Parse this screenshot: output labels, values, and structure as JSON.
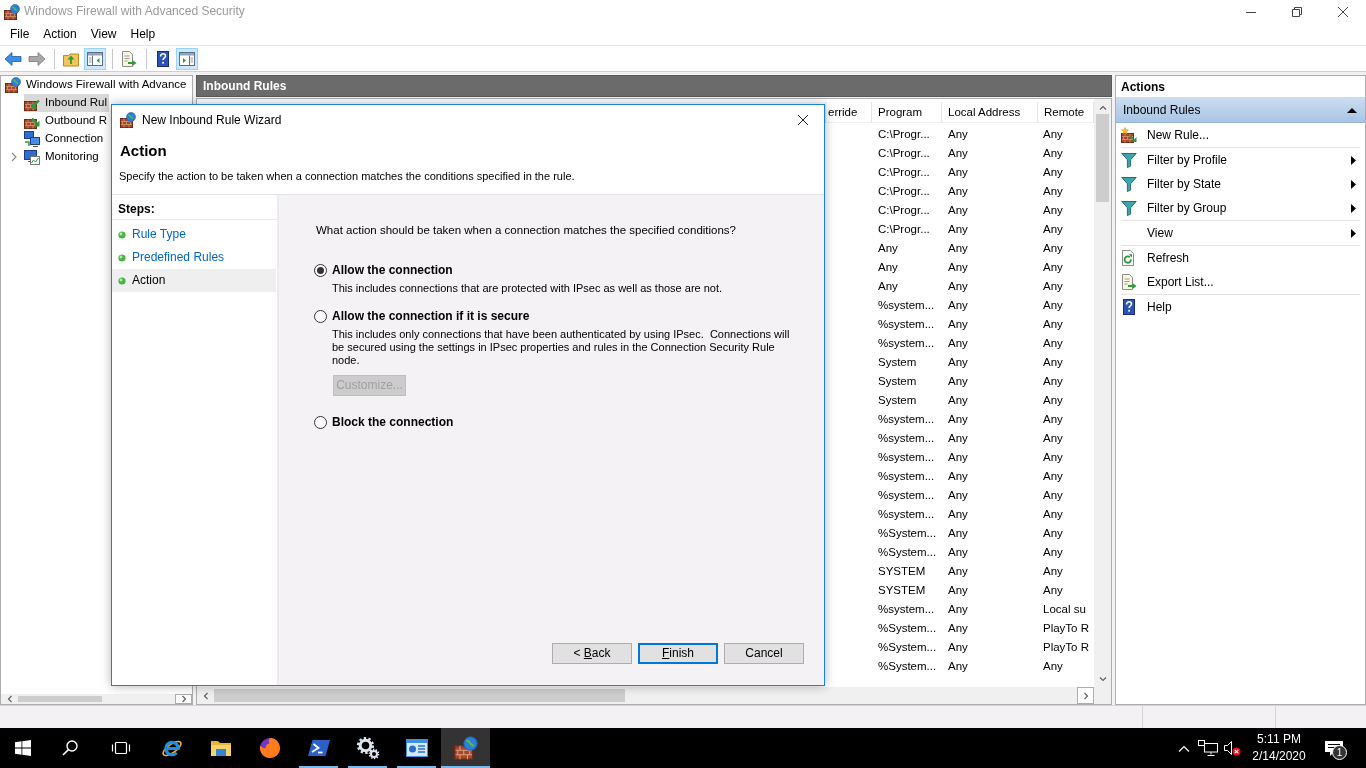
{
  "window": {
    "title": "Windows Firewall with Advanced Security",
    "active": false
  },
  "menu": [
    "File",
    "Action",
    "View",
    "Help"
  ],
  "toolbar": [
    {
      "buttons": [
        {
          "kind": "back",
          "pressed": false,
          "disabled": false
        },
        {
          "kind": "forward",
          "pressed": false,
          "disabled": true
        }
      ]
    },
    {
      "buttons": [
        {
          "kind": "up",
          "pressed": false,
          "disabled": false
        },
        {
          "kind": "console-tree",
          "pressed": true,
          "disabled": false
        }
      ]
    },
    {
      "buttons": [
        {
          "kind": "export",
          "pressed": false,
          "disabled": false
        }
      ]
    },
    {
      "buttons": [
        {
          "kind": "help",
          "pressed": false,
          "disabled": false
        },
        {
          "kind": "action-pane",
          "pressed": true,
          "disabled": false
        }
      ]
    }
  ],
  "tree": [
    {
      "label": "Windows Firewall with Advance",
      "kind": "root",
      "selected": false,
      "children": [
        {
          "label": "Inbound Rul",
          "kind": "inbound",
          "selected": true
        },
        {
          "label": "Outbound R",
          "kind": "outbound",
          "selected": false
        },
        {
          "label": "Connection",
          "kind": "connection",
          "selected": false
        },
        {
          "label": "Monitoring",
          "kind": "monitoring",
          "selected": false,
          "expanded": false
        }
      ]
    }
  ],
  "center": {
    "title": "Inbound Rules",
    "table": {
      "columns": [
        "erride",
        "Program",
        "Local Address",
        "Remote"
      ],
      "rows": [
        [
          "",
          "C:\\Progr...",
          "Any",
          "Any"
        ],
        [
          "",
          "C:\\Progr...",
          "Any",
          "Any"
        ],
        [
          "",
          "C:\\Progr...",
          "Any",
          "Any"
        ],
        [
          "",
          "C:\\Progr...",
          "Any",
          "Any"
        ],
        [
          "",
          "C:\\Progr...",
          "Any",
          "Any"
        ],
        [
          "",
          "C:\\Progr...",
          "Any",
          "Any"
        ],
        [
          "",
          "Any",
          "Any",
          "Any"
        ],
        [
          "",
          "Any",
          "Any",
          "Any"
        ],
        [
          "",
          "Any",
          "Any",
          "Any"
        ],
        [
          "",
          "%system...",
          "Any",
          "Any"
        ],
        [
          "",
          "%system...",
          "Any",
          "Any"
        ],
        [
          "",
          "%system...",
          "Any",
          "Any"
        ],
        [
          "",
          "System",
          "Any",
          "Any"
        ],
        [
          "",
          "System",
          "Any",
          "Any"
        ],
        [
          "",
          "System",
          "Any",
          "Any"
        ],
        [
          "",
          "%system...",
          "Any",
          "Any"
        ],
        [
          "",
          "%system...",
          "Any",
          "Any"
        ],
        [
          "",
          "%system...",
          "Any",
          "Any"
        ],
        [
          "",
          "%system...",
          "Any",
          "Any"
        ],
        [
          "",
          "%system...",
          "Any",
          "Any"
        ],
        [
          "",
          "%system...",
          "Any",
          "Any"
        ],
        [
          "",
          "%System...",
          "Any",
          "Any"
        ],
        [
          "",
          "%System...",
          "Any",
          "Any"
        ],
        [
          "",
          "SYSTEM",
          "Any",
          "Any"
        ],
        [
          "",
          "SYSTEM",
          "Any",
          "Any"
        ],
        [
          "",
          "%system...",
          "Any",
          "Local su"
        ],
        [
          "",
          "%System...",
          "Any",
          "PlayTo R"
        ],
        [
          "",
          "%System...",
          "Any",
          "PlayTo R"
        ],
        [
          "",
          "%System...",
          "Any",
          "Any"
        ]
      ]
    }
  },
  "actions": {
    "title": "Actions",
    "section": {
      "title": "Inbound Rules",
      "expanded": true,
      "groups": [
        {
          "items": [
            {
              "label": "New Rule...",
              "kind": "new-rule",
              "submenu": false
            }
          ]
        },
        {
          "items": [
            {
              "label": "Filter by Profile",
              "kind": "filter",
              "submenu": true
            },
            {
              "label": "Filter by State",
              "kind": "filter",
              "submenu": true
            },
            {
              "label": "Filter by Group",
              "kind": "filter",
              "submenu": true
            }
          ]
        },
        {
          "items": [
            {
              "label": "View",
              "kind": "plain",
              "submenu": true
            }
          ]
        },
        {
          "items": [
            {
              "label": "Refresh",
              "kind": "refresh",
              "submenu": false
            },
            {
              "label": "Export List...",
              "kind": "export",
              "submenu": false
            }
          ]
        },
        {
          "items": [
            {
              "label": "Help",
              "kind": "help",
              "submenu": false
            }
          ]
        }
      ]
    }
  },
  "dialog": {
    "title": "New Inbound Rule Wizard",
    "heading": "Action",
    "description": "Specify the action to be taken when a connection matches the conditions specified in the rule.",
    "steps_title": "Steps:",
    "steps": [
      {
        "label": "Rule Type",
        "selected": false
      },
      {
        "label": "Predefined Rules",
        "selected": false
      },
      {
        "label": "Action",
        "selected": true
      }
    ],
    "question": "What action should be taken when a connection matches the specified conditions?",
    "options": [
      {
        "label": "Allow the connection",
        "selected": true,
        "description": "This includes connections that are protected with IPsec as well as those are not."
      },
      {
        "label": "Allow the connection if it is secure",
        "selected": false,
        "description": "This includes only connections that have been authenticated by using IPsec.  Connections will be secured using the settings in IPsec properties and rules in the Connection Security Rule node.",
        "button": {
          "label": "Customize...",
          "disabled": true
        }
      },
      {
        "label": "Block the connection",
        "selected": false
      }
    ],
    "buttons": [
      {
        "parts": [
          {
            "text": "< ",
            "underline": false
          },
          {
            "text": "B",
            "underline": true
          },
          {
            "text": "ack",
            "underline": false
          }
        ],
        "default": false,
        "disabled": false
      },
      {
        "parts": [
          {
            "text": "F",
            "underline": true
          },
          {
            "text": "inish",
            "underline": false
          }
        ],
        "default": true,
        "disabled": false
      },
      {
        "parts": [
          {
            "text": "Cancel",
            "underline": false
          }
        ],
        "default": false,
        "disabled": false
      }
    ]
  },
  "taskbar": {
    "system_buttons": [
      {
        "kind": "start"
      },
      {
        "kind": "search"
      },
      {
        "kind": "task-view"
      }
    ],
    "apps": [
      {
        "kind": "ie",
        "running": false,
        "active": false
      },
      {
        "kind": "explorer",
        "running": false,
        "active": false
      },
      {
        "kind": "firefox",
        "running": false,
        "active": false
      },
      {
        "kind": "powershell",
        "running": true,
        "active": false
      },
      {
        "kind": "settings",
        "running": true,
        "active": false
      },
      {
        "kind": "window-chart",
        "running": true,
        "active": false
      },
      {
        "kind": "firewall",
        "running": true,
        "active": true
      }
    ],
    "tray": {
      "muted": true,
      "time": "5:11 PM",
      "date": "2/14/2020",
      "notifications": "1"
    }
  }
}
